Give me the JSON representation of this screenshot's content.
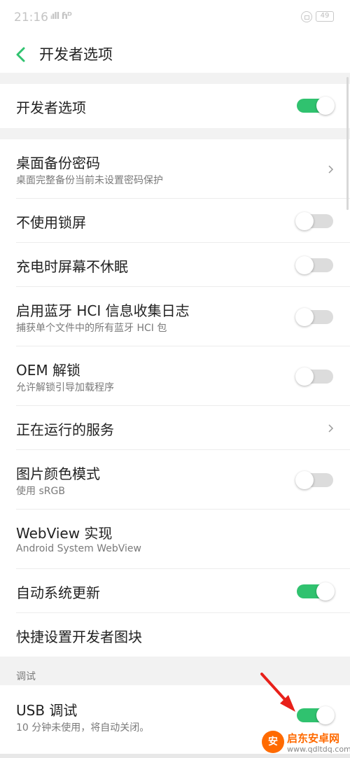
{
  "status_bar": {
    "time": "21:16",
    "signal": "ᵢıll ɦᴰ",
    "battery": "49"
  },
  "header": {
    "title": "开发者选项"
  },
  "master": {
    "label": "开发者选项",
    "on": true
  },
  "rows": [
    {
      "label": "桌面备份密码",
      "sub": "桌面完整备份当前未设置密码保护",
      "control": "chevron"
    },
    {
      "label": "不使用锁屏",
      "sub": "",
      "control": "toggle",
      "on": false
    },
    {
      "label": "充电时屏幕不休眠",
      "sub": "",
      "control": "toggle",
      "on": false
    },
    {
      "label": "启用蓝牙 HCI 信息收集日志",
      "sub": "捕获单个文件中的所有蓝牙 HCI 包",
      "control": "toggle",
      "on": false
    },
    {
      "label": "OEM 解锁",
      "sub": "允许解锁引导加载程序",
      "control": "toggle",
      "on": false
    },
    {
      "label": "正在运行的服务",
      "sub": "",
      "control": "chevron"
    },
    {
      "label": "图片颜色模式",
      "sub": "使用 sRGB",
      "control": "toggle",
      "on": false
    },
    {
      "label": "WebView 实现",
      "sub": "Android System WebView",
      "control": "none"
    },
    {
      "label": "自动系统更新",
      "sub": "",
      "control": "toggle",
      "on": true
    },
    {
      "label": "快捷设置开发者图块",
      "sub": "",
      "control": "none"
    }
  ],
  "section": {
    "title": "调试"
  },
  "usb_debug": {
    "label": "USB 调试",
    "sub": "10 分钟未使用，将自动关闭。",
    "on": true
  },
  "watermark": {
    "name": "启东安卓网",
    "url": "www.qdltdq.com"
  },
  "colors": {
    "accent": "#30c26f",
    "annotation_arrow": "#e8201a"
  }
}
